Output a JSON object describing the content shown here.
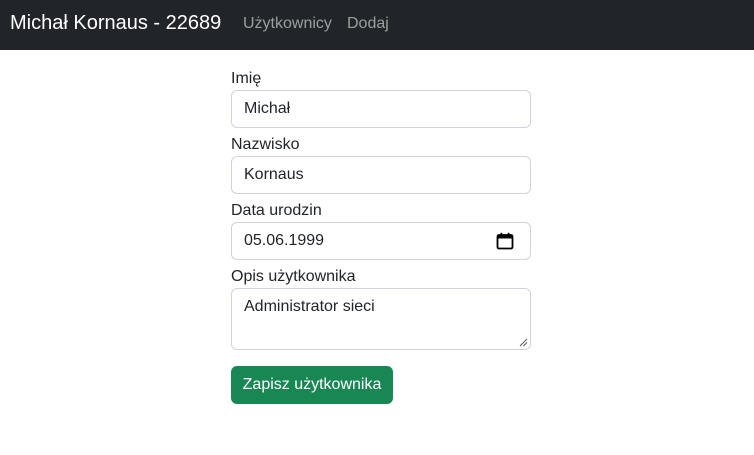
{
  "navbar": {
    "brand": "Michał Kornaus - 22689",
    "links": [
      {
        "label": "Użytkownicy"
      },
      {
        "label": "Dodaj"
      }
    ]
  },
  "form": {
    "first_name": {
      "label": "Imię",
      "value": "Michał"
    },
    "last_name": {
      "label": "Nazwisko",
      "value": "Kornaus"
    },
    "birth_date": {
      "label": "Data urodzin",
      "value": "05.06.1999"
    },
    "description": {
      "label": "Opis użytkownika",
      "value": "Administrator sieci"
    },
    "submit_label": "Zapisz użytkownika"
  },
  "colors": {
    "navbar_bg": "#212529",
    "button_bg": "#198754",
    "border": "#ced4da"
  },
  "icons": {
    "date_picker": "calendar-icon"
  }
}
